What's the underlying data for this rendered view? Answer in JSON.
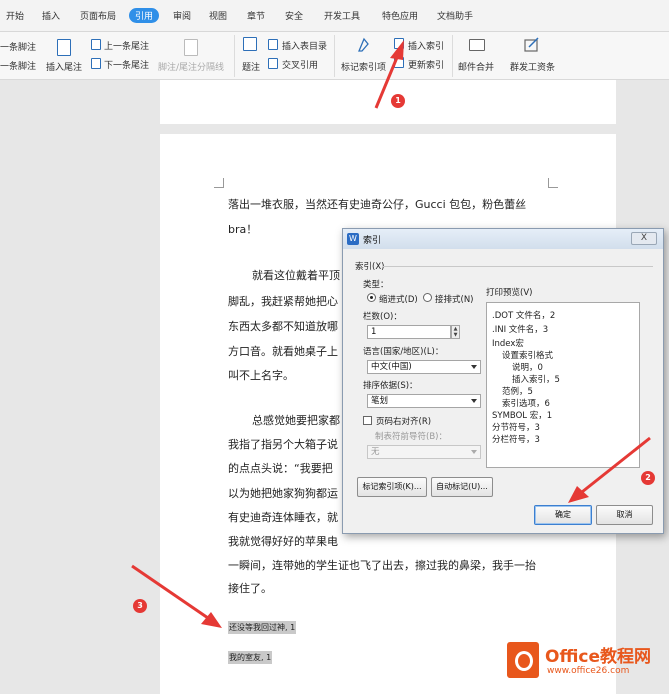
{
  "menubar": {
    "items": [
      "开始",
      "插入",
      "页面布局",
      "引用",
      "审阅",
      "视图",
      "章节",
      "安全",
      "开发工具",
      "特色应用",
      "文档助手"
    ],
    "active_index": 3
  },
  "ribbon": {
    "prev_footnote": "一条脚注",
    "next_footnote": "一条脚注",
    "insert_endnote": "插入尾注",
    "prev_endnote": "上一条尾注",
    "next_endnote": "下一条尾注",
    "separator": "脚注/尾注分隔线",
    "caption": "题注",
    "insert_table_of_figures": "插入表目录",
    "cross_reference": "交叉引用",
    "mark_entry": "标记索引项",
    "insert_index": "插入索引",
    "update_index": "更新索引",
    "mail_merge": "邮件合并",
    "payroll": "群发工资条"
  },
  "document": {
    "lines": [
      "落出一堆衣服，当然还有史迪奇公仔，Gucci 包包，粉色蕾丝",
      "bra！",
      "就看这位戴着平顶",
      "脚乱，我赶紧帮她把心",
      "东西太多都不知道放哪",
      "方口音。就看她桌子上",
      "叫不上名字。",
      "总感觉她要把家都",
      "我指了指另个大箱子说",
      "的点点头说：“我要把",
      "以为她把她家狗狗都运",
      "有史迪奇连体睡衣，就",
      "我就觉得好好的苹果电",
      "一瞬间，连带她的学生证也飞了出去，擦过我的鼻梁，我手一抬",
      "接住了。"
    ],
    "entries": [
      "还没等我回过神, 1",
      "我的室友, 1"
    ]
  },
  "dialog": {
    "title": "索引",
    "close": "X",
    "index_group": "索引(X)",
    "type_label": "类型：",
    "indent_option": "缩进式(D)",
    "runin_option": "接排式(N)",
    "columns_label": "栏数(O)：",
    "columns_value": "1",
    "language_label": "语言(国家/地区)(L)：",
    "language_value": "中文(中国)",
    "sort_label": "排序依据(S)：",
    "sort_value": "笔划",
    "align_right_label": "页码右对齐(R)",
    "tab_leader_label": "制表符前导符(B)：",
    "tab_leader_value": "无",
    "preview_label": "打印预览(V)",
    "preview_lines": [
      ".DOT 文件名，2",
      ".INI 文件名，3",
      "Index宏",
      "设置索引格式",
      "说明，0",
      "插入索引，5",
      "范例，5",
      "索引选项，6",
      "SYMBOL 宏，1",
      "分节符号，3",
      "分栏符号，3"
    ],
    "preview_indent_levels": [
      0,
      0,
      0,
      1,
      2,
      2,
      1,
      1,
      0,
      0,
      0
    ],
    "mark_button": "标记索引项(K)...",
    "auto_mark_button": "自动标记(U)...",
    "ok_button": "确定",
    "cancel_button": "取消"
  },
  "annotations": {
    "steps": [
      "1",
      "2",
      "3"
    ],
    "color": "#e53935"
  },
  "watermark": {
    "name": "Office教程网",
    "url": "www.office26.com"
  }
}
